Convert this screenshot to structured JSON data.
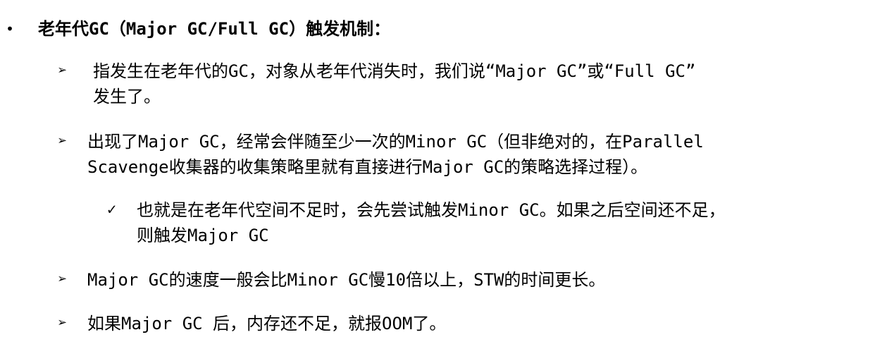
{
  "heading": {
    "bullet": "•",
    "text": "老年代GC（Major GC/Full GC）触发机制："
  },
  "items": [
    {
      "marker": "➢",
      "lines": [
        "指发生在老年代的GC，对象从老年代消失时，我们说“Major GC”或“Full GC”",
        "发生了。"
      ]
    },
    {
      "marker": "➢",
      "lines": [
        "出现了Major GC，经常会伴随至少一次的Minor GC（但非绝对的，在Parallel",
        "Scavenge收集器的收集策略里就有直接进行Major GC的策略选择过程）。"
      ]
    },
    {
      "marker": "✓",
      "lines": [
        "也就是在老年代空间不足时，会先尝试触发Minor GC。如果之后空间还不足，",
        "则触发Major GC"
      ]
    },
    {
      "marker": "➢",
      "lines": [
        "Major GC的速度一般会比Minor GC慢10倍以上，STW的时间更长。"
      ]
    },
    {
      "marker": "➢",
      "lines": [
        "如果Major GC 后，内存还不足，就报OOM了。"
      ]
    }
  ]
}
